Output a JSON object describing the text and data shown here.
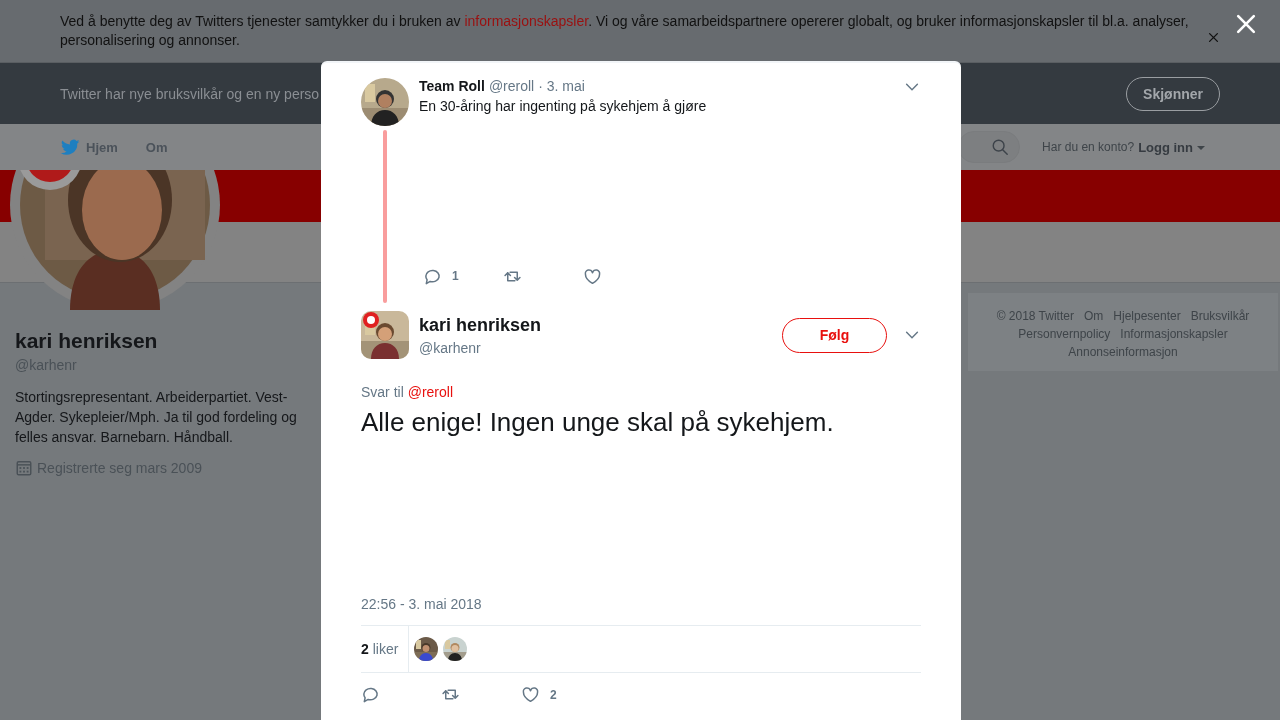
{
  "cookie_notice": {
    "text_before": "Ved å benytte deg av Twitters tjenester samtykker du i bruken av ",
    "link": "informasjonskapsler",
    "text_after": ". Vi og våre samarbeidspartnere opererer globalt, og bruker informasjonskapsler til bl.a. analyser, personalisering og annonser."
  },
  "terms_banner": {
    "text": "Twitter har nye bruksvilkår og en ny perso",
    "button": "Skjønner"
  },
  "nav": {
    "items": [
      {
        "label": "Hjem",
        "kind": "home"
      },
      {
        "label": "Om",
        "kind": "link"
      }
    ],
    "login_prompt": "Har du en konto?",
    "login": "Logg inn"
  },
  "profile": {
    "name": "kari henriksen",
    "handle": "@karhenr",
    "bio": "Stortingsrepresentant. Arbeiderpartiet. Vest-Agder. Sykepleier/Mph. Ja til god fordeling og felles ansvar. Barnebarn. Håndball.",
    "joined": "Registrerte seg mars 2009"
  },
  "footer_links": [
    "© 2018 Twitter",
    "Om",
    "Hjelpesenter",
    "Bruksvilkår",
    "Personvernpolicy",
    "Informasjonskapsler",
    "Annonseinformasjon"
  ],
  "modal": {
    "parent_tweet": {
      "name": "Team Roll",
      "handle": "@reroll",
      "time": "· 3. mai",
      "text": "En 30-åring har ingenting på sykehjem å gjøre",
      "actions": [
        {
          "kind": "reply",
          "count": "1"
        },
        {
          "kind": "retweet"
        },
        {
          "kind": "like"
        }
      ]
    },
    "tweet": {
      "name": "kari henriksen",
      "handle": "@karhenr",
      "follow_button": "Følg",
      "reply_prefix": "Svar til",
      "reply_to": "@reroll",
      "text": "Alle enige! Ingen unge skal på sykehjem.",
      "timestamp": "22:56 - 3. mai 2018",
      "likes": "**2** liker",
      "actions": [
        {
          "kind": "reply"
        },
        {
          "kind": "retweet"
        },
        {
          "kind": "like",
          "count": "2"
        }
      ]
    }
  }
}
